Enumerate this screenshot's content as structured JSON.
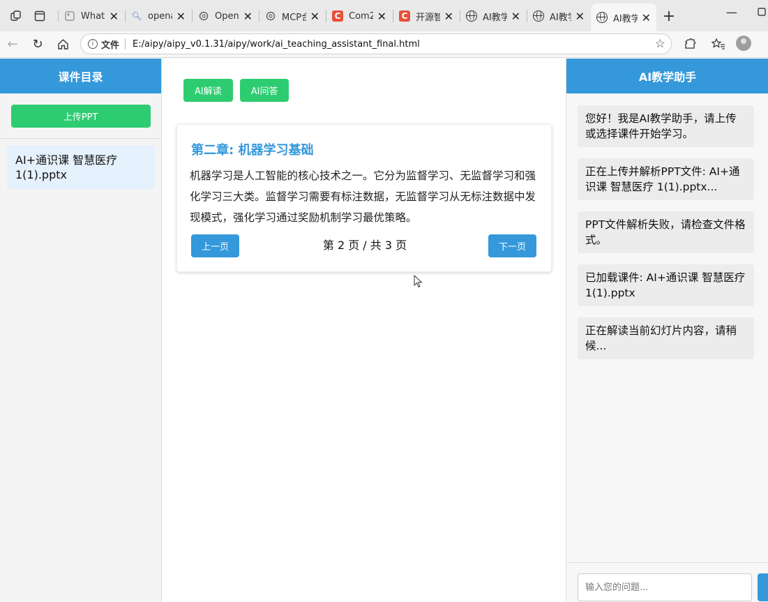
{
  "browser": {
    "tabs": [
      {
        "title": "What i",
        "icon": "image-icon"
      },
      {
        "title": "opena",
        "icon": "search-icon"
      },
      {
        "title": "OpenA",
        "icon": "openai-icon"
      },
      {
        "title": "MCP合",
        "icon": "openai-icon"
      },
      {
        "title": "Com2",
        "icon": "c-logo-icon"
      },
      {
        "title": "开源智",
        "icon": "c-logo-icon"
      },
      {
        "title": "AI教学",
        "icon": "globe-icon"
      },
      {
        "title": "AI教学",
        "icon": "globe-icon"
      },
      {
        "title": "AI教学",
        "icon": "globe-icon",
        "active": true
      }
    ],
    "address": {
      "scheme_label": "文件",
      "url": "E:/aipy/aipy_v0.1.31/aipy/work/ai_teaching_assistant_final.html"
    }
  },
  "left_panel": {
    "header": "课件目录",
    "upload_label": "上传PPT",
    "files": [
      "AI+通识课 智慧医疗 1(1).pptx"
    ]
  },
  "center_panel": {
    "buttons": {
      "interpret": "AI解读",
      "qa": "AI问答"
    },
    "slide": {
      "title": "第二章: 机器学习基础",
      "body": "机器学习是人工智能的核心技术之一。它分为监督学习、无监督学习和强化学习三大类。监督学习需要有标注数据，无监督学习从无标注数据中发现模式，强化学习通过奖励机制学习最优策略。"
    },
    "pager": {
      "prev": "上一页",
      "next": "下一页",
      "status": "第 2 页 / 共 3 页"
    }
  },
  "right_panel": {
    "header": "AI教学助手",
    "messages": [
      "您好！我是AI教学助手，请上传或选择课件开始学习。",
      "正在上传并解析PPT文件: AI+通识课 智慧医疗 1(1).pptx...",
      "PPT文件解析失败，请检查文件格式。",
      "已加载课件: AI+通识课 智慧医疗 1(1).pptx",
      "正在解读当前幻灯片内容，请稍候..."
    ],
    "input_placeholder": "输入您的问题..."
  },
  "colors": {
    "primary": "#3498db",
    "accent_green": "#2ecc71",
    "file_highlight": "#e5f1fc"
  }
}
